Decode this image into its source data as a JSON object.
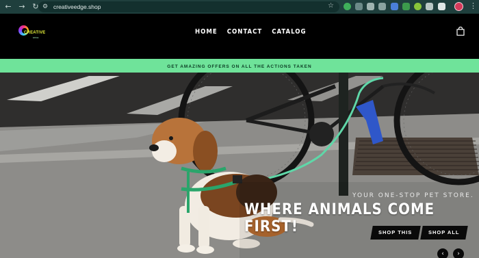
{
  "browser": {
    "url": "creativeedge.shop",
    "back_glyph": "←",
    "forward_glyph": "→",
    "reload_glyph": "↻",
    "site_info_glyph": "⚙",
    "bookmark_glyph": "☆",
    "menu_glyph": "⋮",
    "extension_icons": [
      "extension-icon",
      "extension-icon",
      "extension-icon",
      "extension-icon",
      "extension-icon",
      "extension-icon",
      "extension-icon",
      "extension-icon",
      "extension-icon"
    ]
  },
  "header": {
    "logo_text": "CREATIVE",
    "logo_subtext": "EDGE",
    "nav": [
      "HOME",
      "CONTACT",
      "CATALOG"
    ],
    "cart_icon": "shopping-bag-icon"
  },
  "promo": {
    "text": "GET AMAZING OFFERS ON ALL THE ACTIONS TAKEN"
  },
  "hero": {
    "subtitle": "YOUR ONE-STOP PET STORE.",
    "headline": "WHERE ANIMALS COME FIRST!",
    "buttons": [
      "SHOP THIS",
      "SHOP ALL"
    ],
    "prev_glyph": "‹",
    "next_glyph": "›",
    "image": "beagle-on-leash-by-bicycles-photo"
  },
  "colors": {
    "chrome_bg": "#1f3f3d",
    "header_bg": "#000000",
    "promo_bg": "#6fe39a",
    "leash": "#5fd7a8",
    "button_bg": "#0a0a0a"
  }
}
